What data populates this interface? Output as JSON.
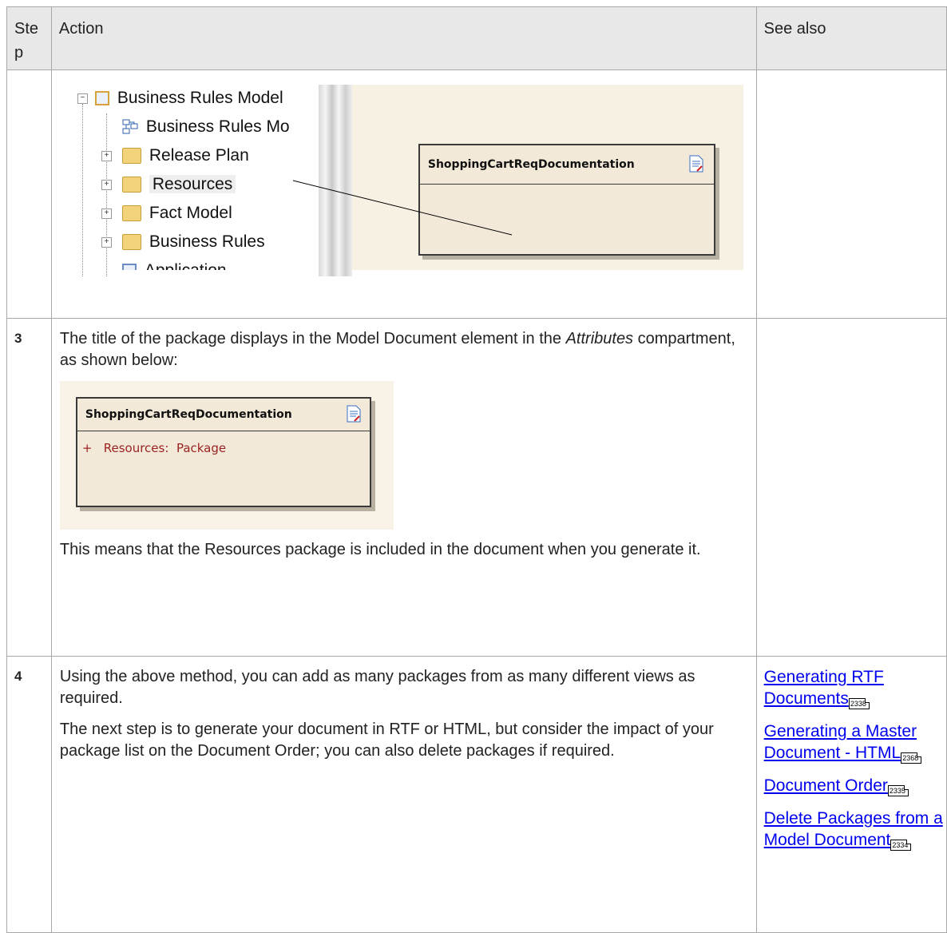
{
  "header": {
    "step": "Ste\np",
    "action": "Action",
    "see_also": "See also"
  },
  "row_diagram": {
    "tree": {
      "root": "Business Rules Model",
      "items": [
        "Business Rules Mo",
        "Release Plan",
        "Resources",
        "Fact Model",
        "Business Rules",
        "Application"
      ]
    },
    "element_title": "ShoppingCartReqDocumentation"
  },
  "row3": {
    "step": "3",
    "text_pre": "The title of the package displays in the Model Document element in the ",
    "text_em": "Attributes",
    "text_post": " compartment, as shown below:",
    "element_title": "ShoppingCartReqDocumentation",
    "attribute": "+   Resources:  Package",
    "text2": "This means that the Resources package is included in the document when you generate it."
  },
  "row4": {
    "step": "4",
    "para1": "Using the above method, you can add as many packages from as many different views as required.",
    "para2": "The next step is to generate your document in RTF or HTML, but consider the impact of your package list on the Document Order; you can also delete packages if required.",
    "links": [
      {
        "label": "Generating RTF Documents",
        "page": "2338"
      },
      {
        "label": "Generating a Master Document - HTML",
        "page": "2368"
      },
      {
        "label": "Document Order",
        "page": "2335"
      },
      {
        "label": "Delete Packages from a Model Document",
        "page": "2334"
      }
    ]
  }
}
